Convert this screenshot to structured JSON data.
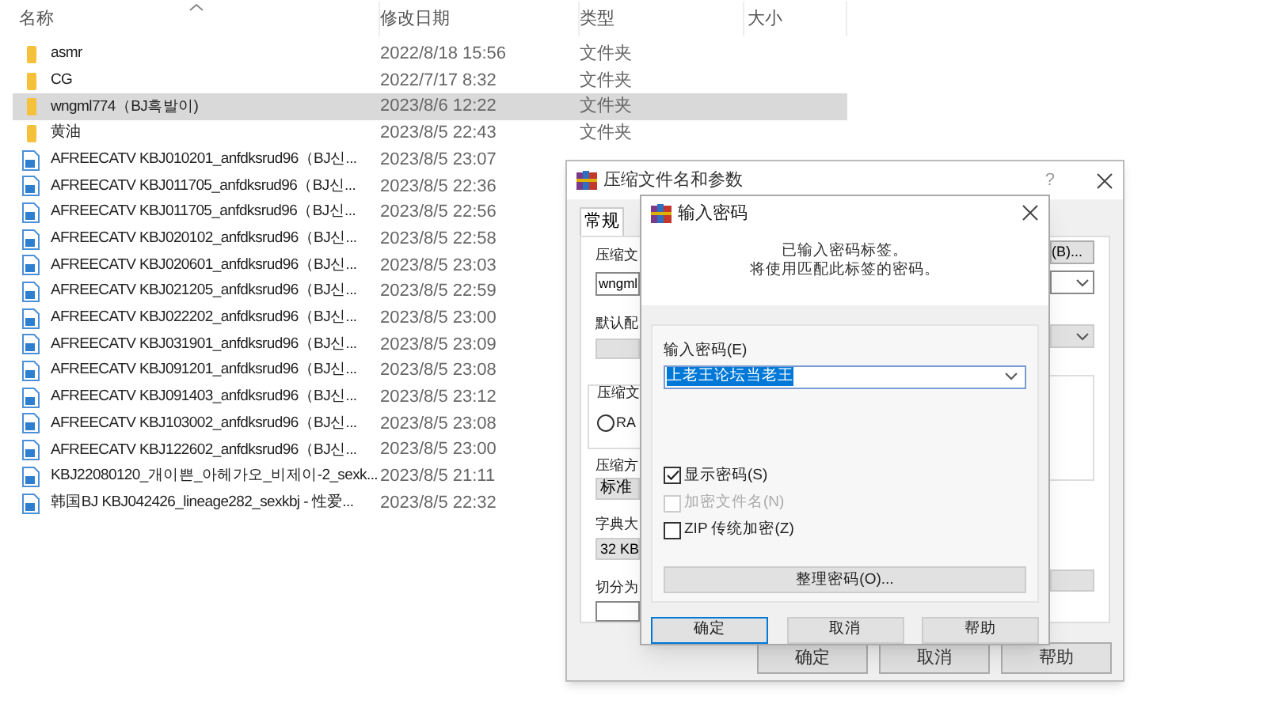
{
  "file_list": {
    "columns": [
      "名称",
      "修改日期",
      "类型",
      "大小"
    ],
    "rows": [
      {
        "kind": "folder",
        "name": "asmr",
        "date": "2022/8/18 15:56",
        "type": "文件夹",
        "selected": false
      },
      {
        "kind": "folder",
        "name": "CG",
        "date": "2022/7/17 8:32",
        "type": "文件夹",
        "selected": false
      },
      {
        "kind": "folder",
        "name": "wngml774（BJ흑발이)",
        "date": "2023/8/6 12:22",
        "type": "文件夹",
        "selected": true
      },
      {
        "kind": "folder",
        "name": "黄油",
        "date": "2023/8/5 22:43",
        "type": "文件夹",
        "selected": false
      },
      {
        "kind": "video",
        "name": "AFREECATV KBJ010201_anfdksrud96（BJ신...",
        "date": "2023/8/5 23:07",
        "selected": false
      },
      {
        "kind": "video",
        "name": "AFREECATV KBJ011705_anfdksrud96（BJ신...",
        "date": "2023/8/5 22:36",
        "selected": false
      },
      {
        "kind": "video",
        "name": "AFREECATV KBJ011705_anfdksrud96（BJ신...",
        "date": "2023/8/5 22:56",
        "selected": false
      },
      {
        "kind": "video",
        "name": "AFREECATV KBJ020102_anfdksrud96（BJ신...",
        "date": "2023/8/5 22:58",
        "selected": false
      },
      {
        "kind": "video",
        "name": "AFREECATV KBJ020601_anfdksrud96（BJ신...",
        "date": "2023/8/5 23:03",
        "selected": false
      },
      {
        "kind": "video",
        "name": "AFREECATV KBJ021205_anfdksrud96（BJ신...",
        "date": "2023/8/5 22:59",
        "selected": false
      },
      {
        "kind": "video",
        "name": "AFREECATV KBJ022202_anfdksrud96（BJ신...",
        "date": "2023/8/5 23:00",
        "selected": false
      },
      {
        "kind": "video",
        "name": "AFREECATV KBJ031901_anfdksrud96（BJ신...",
        "date": "2023/8/5 23:09",
        "selected": false
      },
      {
        "kind": "video",
        "name": "AFREECATV KBJ091201_anfdksrud96（BJ신...",
        "date": "2023/8/5 23:08",
        "selected": false
      },
      {
        "kind": "video",
        "name": "AFREECATV KBJ091403_anfdksrud96（BJ신...",
        "date": "2023/8/5 23:12",
        "selected": false
      },
      {
        "kind": "video",
        "name": "AFREECATV KBJ103002_anfdksrud96（BJ신...",
        "date": "2023/8/5 23:08",
        "selected": false
      },
      {
        "kind": "video",
        "name": "AFREECATV KBJ122602_anfdksrud96（BJ신...",
        "date": "2023/8/5 23:00",
        "selected": false
      },
      {
        "kind": "video",
        "name": "KBJ22080120_개이쁜_아헤가오_비제이-2_sexk...",
        "date": "2023/8/5 21:11",
        "selected": false
      },
      {
        "kind": "video",
        "name": "韩国BJ KBJ042426_lineage282_sexkbj - 性爱...",
        "date": "2023/8/5 22:32",
        "selected": false
      }
    ]
  },
  "archive_dialog": {
    "title": "压缩文件名和参数",
    "help": "?",
    "tabs": [
      {
        "label": "常规",
        "selected": true
      }
    ],
    "archive_name_label": "压缩文",
    "archive_name_value": "wngml",
    "browse_button": "(B)...",
    "profile_label": "默认配",
    "format_label": "压缩文",
    "format_radio": {
      "label": "RA",
      "checked": false
    },
    "method_label": "压缩方",
    "method_value": "标准",
    "dictionary_label": "字典大",
    "dictionary_value": "32 KB",
    "split_label": "切分为",
    "buttons": [
      "确定",
      "取消",
      "帮助"
    ]
  },
  "password_dialog": {
    "title": "输入密码",
    "message": [
      "已输入密码标签。",
      "将使用匹配此标签的密码。"
    ],
    "password_label": "输入密码(E)",
    "password_value": "上老王论坛当老王",
    "options": [
      {
        "label": "显示密码(S)",
        "checked": true,
        "disabled": false
      },
      {
        "label": "加密文件名(N)",
        "checked": false,
        "disabled": true
      },
      {
        "label": "ZIP 传统加密(Z)",
        "checked": false,
        "disabled": false
      }
    ],
    "organize_button": "整理密码(O)...",
    "buttons": [
      {
        "label": "确定",
        "selected": true
      },
      {
        "label": "取消",
        "selected": false
      },
      {
        "label": "帮助",
        "selected": false
      }
    ]
  }
}
